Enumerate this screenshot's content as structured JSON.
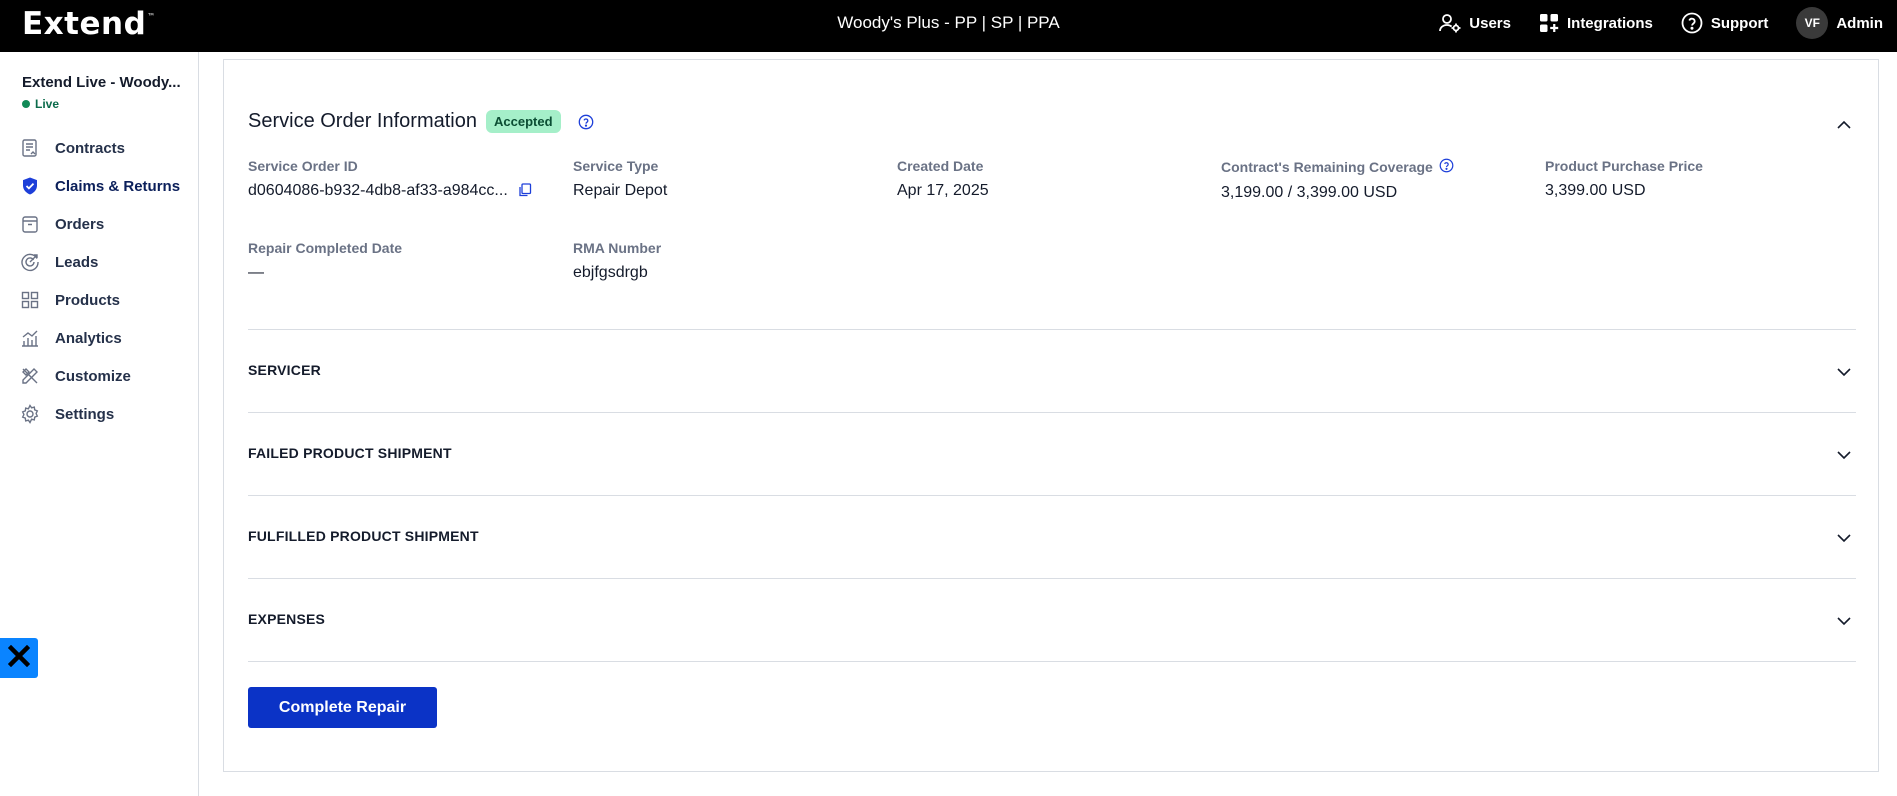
{
  "header": {
    "logo": "Extend",
    "logo_mark": "™",
    "title": "Woody's Plus - PP | SP | PPA",
    "actions": [
      {
        "label": "Users",
        "icon": "users-icon"
      },
      {
        "label": "Integrations",
        "icon": "integrations-icon"
      },
      {
        "label": "Support",
        "icon": "help-circle-icon"
      }
    ],
    "user_initials": "VF",
    "user_role": "Admin"
  },
  "sidebar": {
    "store_name": "Extend Live - Woody...",
    "status": "Live",
    "items": [
      {
        "label": "Contracts",
        "icon": "contract-icon"
      },
      {
        "label": "Claims & Returns",
        "icon": "shield-check-icon",
        "active": true
      },
      {
        "label": "Orders",
        "icon": "bag-icon"
      },
      {
        "label": "Leads",
        "icon": "leads-icon"
      },
      {
        "label": "Products",
        "icon": "grid-icon"
      },
      {
        "label": "Analytics",
        "icon": "chart-icon"
      },
      {
        "label": "Customize",
        "icon": "tools-icon"
      },
      {
        "label": "Settings",
        "icon": "gear-icon"
      }
    ]
  },
  "service_order": {
    "title": "Service Order Information",
    "status": "Accepted",
    "fields": {
      "service_order_id": {
        "label": "Service Order ID",
        "value": "d0604086-b932-4db8-af33-a984cc..."
      },
      "service_type": {
        "label": "Service Type",
        "value": "Repair Depot"
      },
      "created_date": {
        "label": "Created Date",
        "value": "Apr 17, 2025"
      },
      "remaining_coverage": {
        "label": "Contract's Remaining Coverage",
        "value": "3,199.00 / 3,399.00 USD"
      },
      "purchase_price": {
        "label": "Product Purchase Price",
        "value": "3,399.00 USD"
      },
      "repair_completed_date": {
        "label": "Repair Completed Date",
        "value": "—"
      },
      "rma_number": {
        "label": "RMA Number",
        "value": "ebjfgsdrgb"
      }
    },
    "sections": [
      "SERVICER",
      "FAILED PRODUCT SHIPMENT",
      "FULFILLED PRODUCT SHIPMENT",
      "EXPENSES"
    ],
    "primary_action": "Complete Repair"
  },
  "colors": {
    "topbar": "#000000",
    "accent_blue": "#0b33c6",
    "badge_bg": "#a5efc9",
    "live_green": "#118a57",
    "brand_badge": "#0a84ff"
  }
}
